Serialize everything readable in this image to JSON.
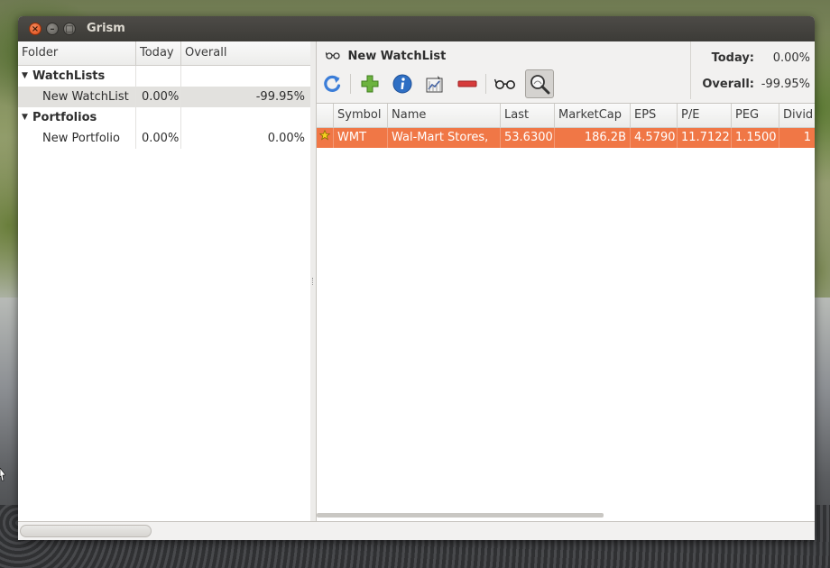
{
  "window": {
    "title": "Grism",
    "close_glyph": "×",
    "minimize_glyph": "–",
    "maximize_glyph": "□"
  },
  "folder_tree": {
    "columns": [
      "Folder",
      "Today",
      "Overall"
    ],
    "groups": [
      {
        "label": "WatchLists",
        "items": [
          {
            "name": "New WatchList",
            "today": "0.00%",
            "overall": "-99.95%",
            "selected": true
          }
        ]
      },
      {
        "label": "Portfolios",
        "items": [
          {
            "name": "New Portfolio",
            "today": "0.00%",
            "overall": "0.00%",
            "selected": false
          }
        ]
      }
    ]
  },
  "watchlist": {
    "title": "New WatchList",
    "title_icon": "glasses-icon"
  },
  "summary": {
    "today_label": "Today:",
    "today_value": "0.00%",
    "overall_label": "Overall:",
    "overall_value": "-99.95%"
  },
  "toolbar": {
    "tools": [
      {
        "name": "refresh-icon",
        "color": "#3b7dd8"
      },
      {
        "name": "add-icon",
        "color": "#6cb33f"
      },
      {
        "name": "info-icon",
        "color": "#2f6fc4"
      },
      {
        "name": "chart-icon",
        "color": "#444444"
      },
      {
        "name": "remove-icon",
        "color": "#d63b3b"
      },
      {
        "name": "glasses-icon",
        "color": "#222222"
      },
      {
        "name": "zoom-icon",
        "color": "#333333",
        "active": true
      }
    ]
  },
  "stock_table": {
    "columns": [
      "",
      "Symbol",
      "Name",
      "Last",
      "MarketCap",
      "EPS",
      "P/E",
      "PEG",
      "Divid"
    ],
    "rows": [
      {
        "star_icon": "star-icon",
        "symbol": "WMT",
        "name": "Wal-Mart Stores,",
        "last": "53.6300",
        "marketcap": "186.2B",
        "eps": "4.5790",
        "pe": "11.7122",
        "peg": "1.1500",
        "divid": "1"
      }
    ],
    "row_highlight_color": "#f07746"
  }
}
